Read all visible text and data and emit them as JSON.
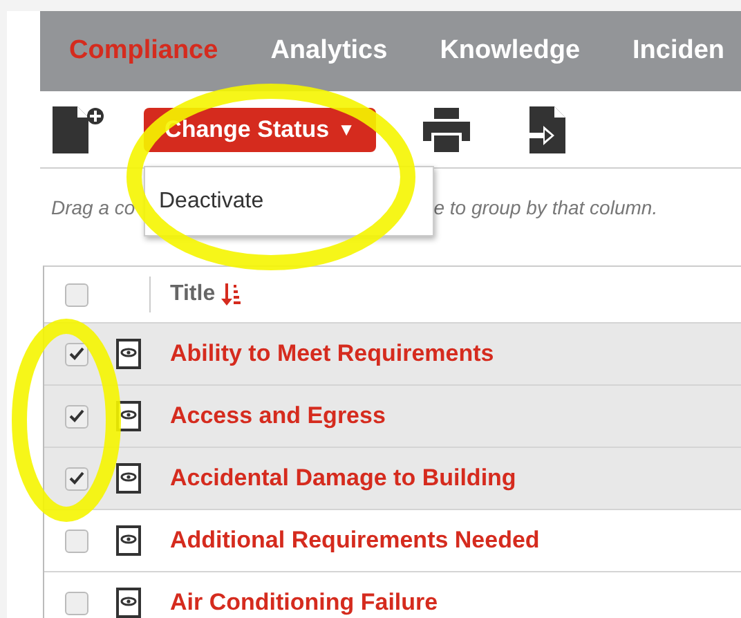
{
  "nav": {
    "tabs": [
      {
        "label": "Compliance",
        "selected": true
      },
      {
        "label": "Analytics",
        "selected": false
      },
      {
        "label": "Knowledge",
        "selected": false
      },
      {
        "label": "Inciden",
        "selected": false
      }
    ]
  },
  "toolbar": {
    "status_button": {
      "label": "Change Status",
      "caret": "▼"
    }
  },
  "status_menu": {
    "items": [
      "Deactivate"
    ]
  },
  "group_hint": {
    "before_menu": "Drag a co",
    "after_menu": "e to group by that column."
  },
  "table": {
    "select_all": {
      "checked": false
    },
    "columns": [
      {
        "label": "Title",
        "sorted": true
      }
    ],
    "rows": [
      {
        "title": "Ability to Meet Requirements",
        "checked": true
      },
      {
        "title": "Access and Egress",
        "checked": true
      },
      {
        "title": "Accidental Damage to Building",
        "checked": true
      },
      {
        "title": "Additional Requirements Needed",
        "checked": false
      },
      {
        "title": "Air Conditioning Failure",
        "checked": false
      }
    ]
  }
}
